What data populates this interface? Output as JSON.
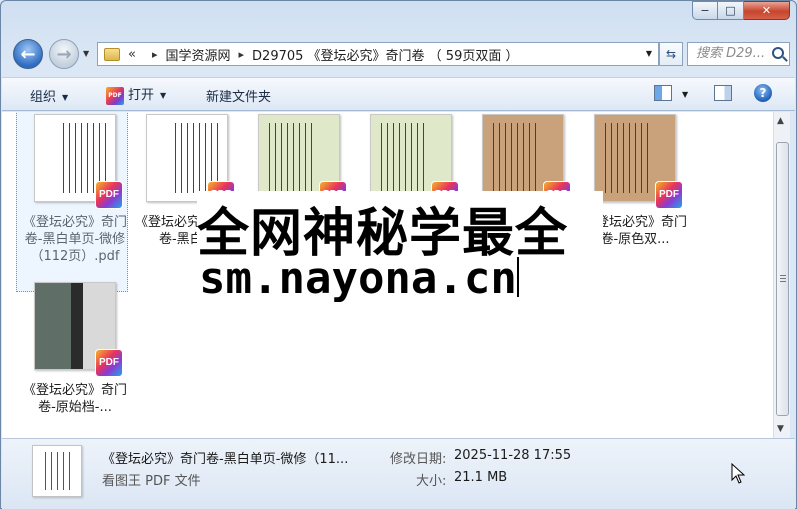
{
  "window": {
    "minimize_glyph": "−",
    "maximize_glyph": "□",
    "close_glyph": "✕"
  },
  "nav": {
    "back_glyph": "←",
    "forward_glyph": "→",
    "address_chevron": "«",
    "breadcrumb": [
      "国学资源网",
      "D29705 《登坛必究》奇门卷 （ 59页双面 ）"
    ],
    "breadcrumb_sep": "▸",
    "refresh_glyph": "⇆",
    "search_placeholder": "搜索 D29..."
  },
  "toolbar": {
    "organize": "组织",
    "open": "打开",
    "new_folder": "新建文件夹",
    "pdf_mini_label": "PDF",
    "help_glyph": "?"
  },
  "files": [
    {
      "label": "《登坛必究》奇门卷-黑白单页-微修（112页）.pdf",
      "tone": "bw",
      "selected": true
    },
    {
      "label": "《登坛必究》奇门卷-黑白...",
      "tone": "bw",
      "selected": false
    },
    {
      "label": "",
      "tone": "green",
      "selected": false
    },
    {
      "label": "",
      "tone": "green",
      "selected": false
    },
    {
      "label": "",
      "tone": "sepia",
      "selected": false
    },
    {
      "label": "《登坛必究》奇门卷-原色双...",
      "tone": "sepia",
      "selected": false
    },
    {
      "label": "《登坛必究》奇门卷-原始档-...",
      "tone": "photo",
      "selected": false
    }
  ],
  "pdf_badge": "PDF",
  "watermark": {
    "line1": "全网神秘学最全",
    "line2": "sm.nayona.cn"
  },
  "details": {
    "name": "《登坛必究》奇门卷-黑白单页-微修（11...",
    "type": "看图王 PDF 文件",
    "modified_label": "修改日期:",
    "modified_value": "2025-11-28 17:55",
    "size_label": "大小:",
    "size_value": "21.1 MB"
  },
  "colors": {
    "bw_page": "#ffffff",
    "green_page": "#dfe9c9",
    "sepia_page": "#c9a27c",
    "selection": "#cce2fc"
  }
}
